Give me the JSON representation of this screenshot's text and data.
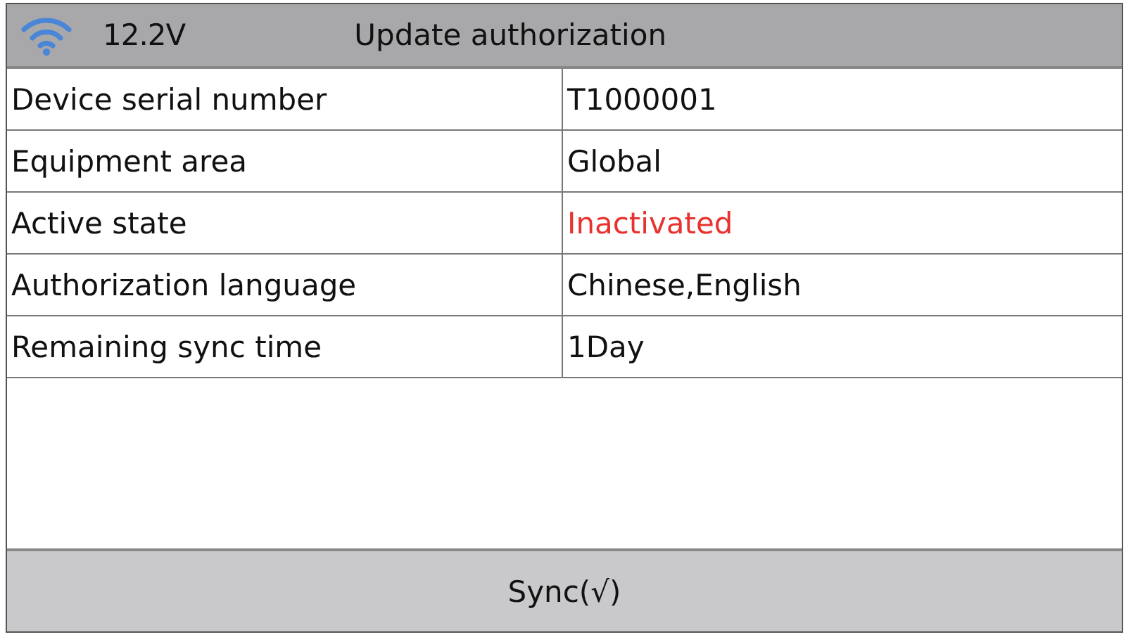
{
  "status_bar": {
    "voltage": "12.2V",
    "title": "Update authorization"
  },
  "rows": [
    {
      "label": "Device serial number",
      "value": "T1000001",
      "kind": "normal"
    },
    {
      "label": "Equipment area",
      "value": "Global",
      "kind": "normal"
    },
    {
      "label": "Active state",
      "value": "Inactivated",
      "kind": "warning"
    },
    {
      "label": "Authorization language",
      "value": "Chinese,English",
      "kind": "normal"
    },
    {
      "label": "Remaining sync time",
      "value": "1Day",
      "kind": "normal"
    }
  ],
  "buttons": [
    "Sync(√)"
  ]
}
